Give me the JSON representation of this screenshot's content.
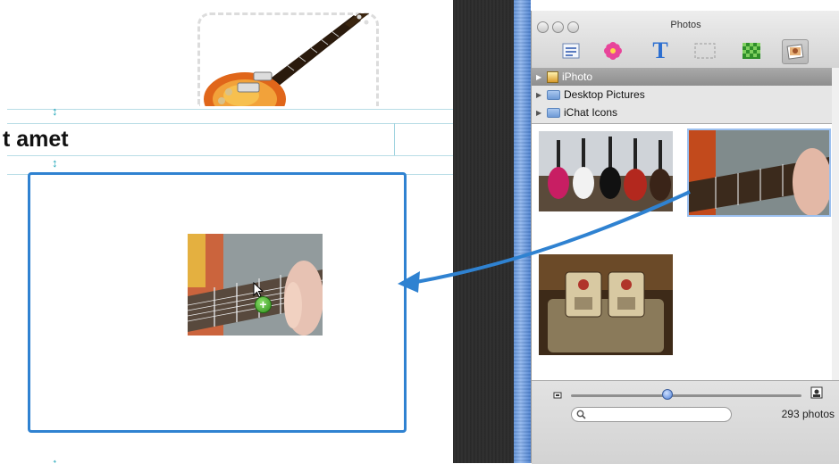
{
  "document": {
    "headline": "t amet"
  },
  "photos_window": {
    "title": "Photos",
    "toolbar": [
      {
        "name": "text-box-icon"
      },
      {
        "name": "shape-flower-icon"
      },
      {
        "name": "text-t-icon"
      },
      {
        "name": "placeholder-icon"
      },
      {
        "name": "pattern-icon"
      },
      {
        "name": "photos-icon"
      }
    ],
    "sources": [
      {
        "label": "iPhoto",
        "selected": true
      },
      {
        "label": "Desktop Pictures",
        "selected": false
      },
      {
        "label": "iChat Icons",
        "selected": false
      }
    ],
    "thumbnails": [
      {
        "name": "guitars-on-stands-thumb"
      },
      {
        "name": "guitar-playing-thumb",
        "selected": true
      },
      {
        "name": "effects-pedals-thumb"
      }
    ],
    "zoom_level": 0.42,
    "search": {
      "placeholder": ""
    },
    "photo_count": "293 photos"
  },
  "colors": {
    "drop_box_border": "#2f82d1",
    "drag_arrow": "#2f82d1",
    "guide_line": "#20a6b8",
    "selection": "#8e8e8e"
  }
}
